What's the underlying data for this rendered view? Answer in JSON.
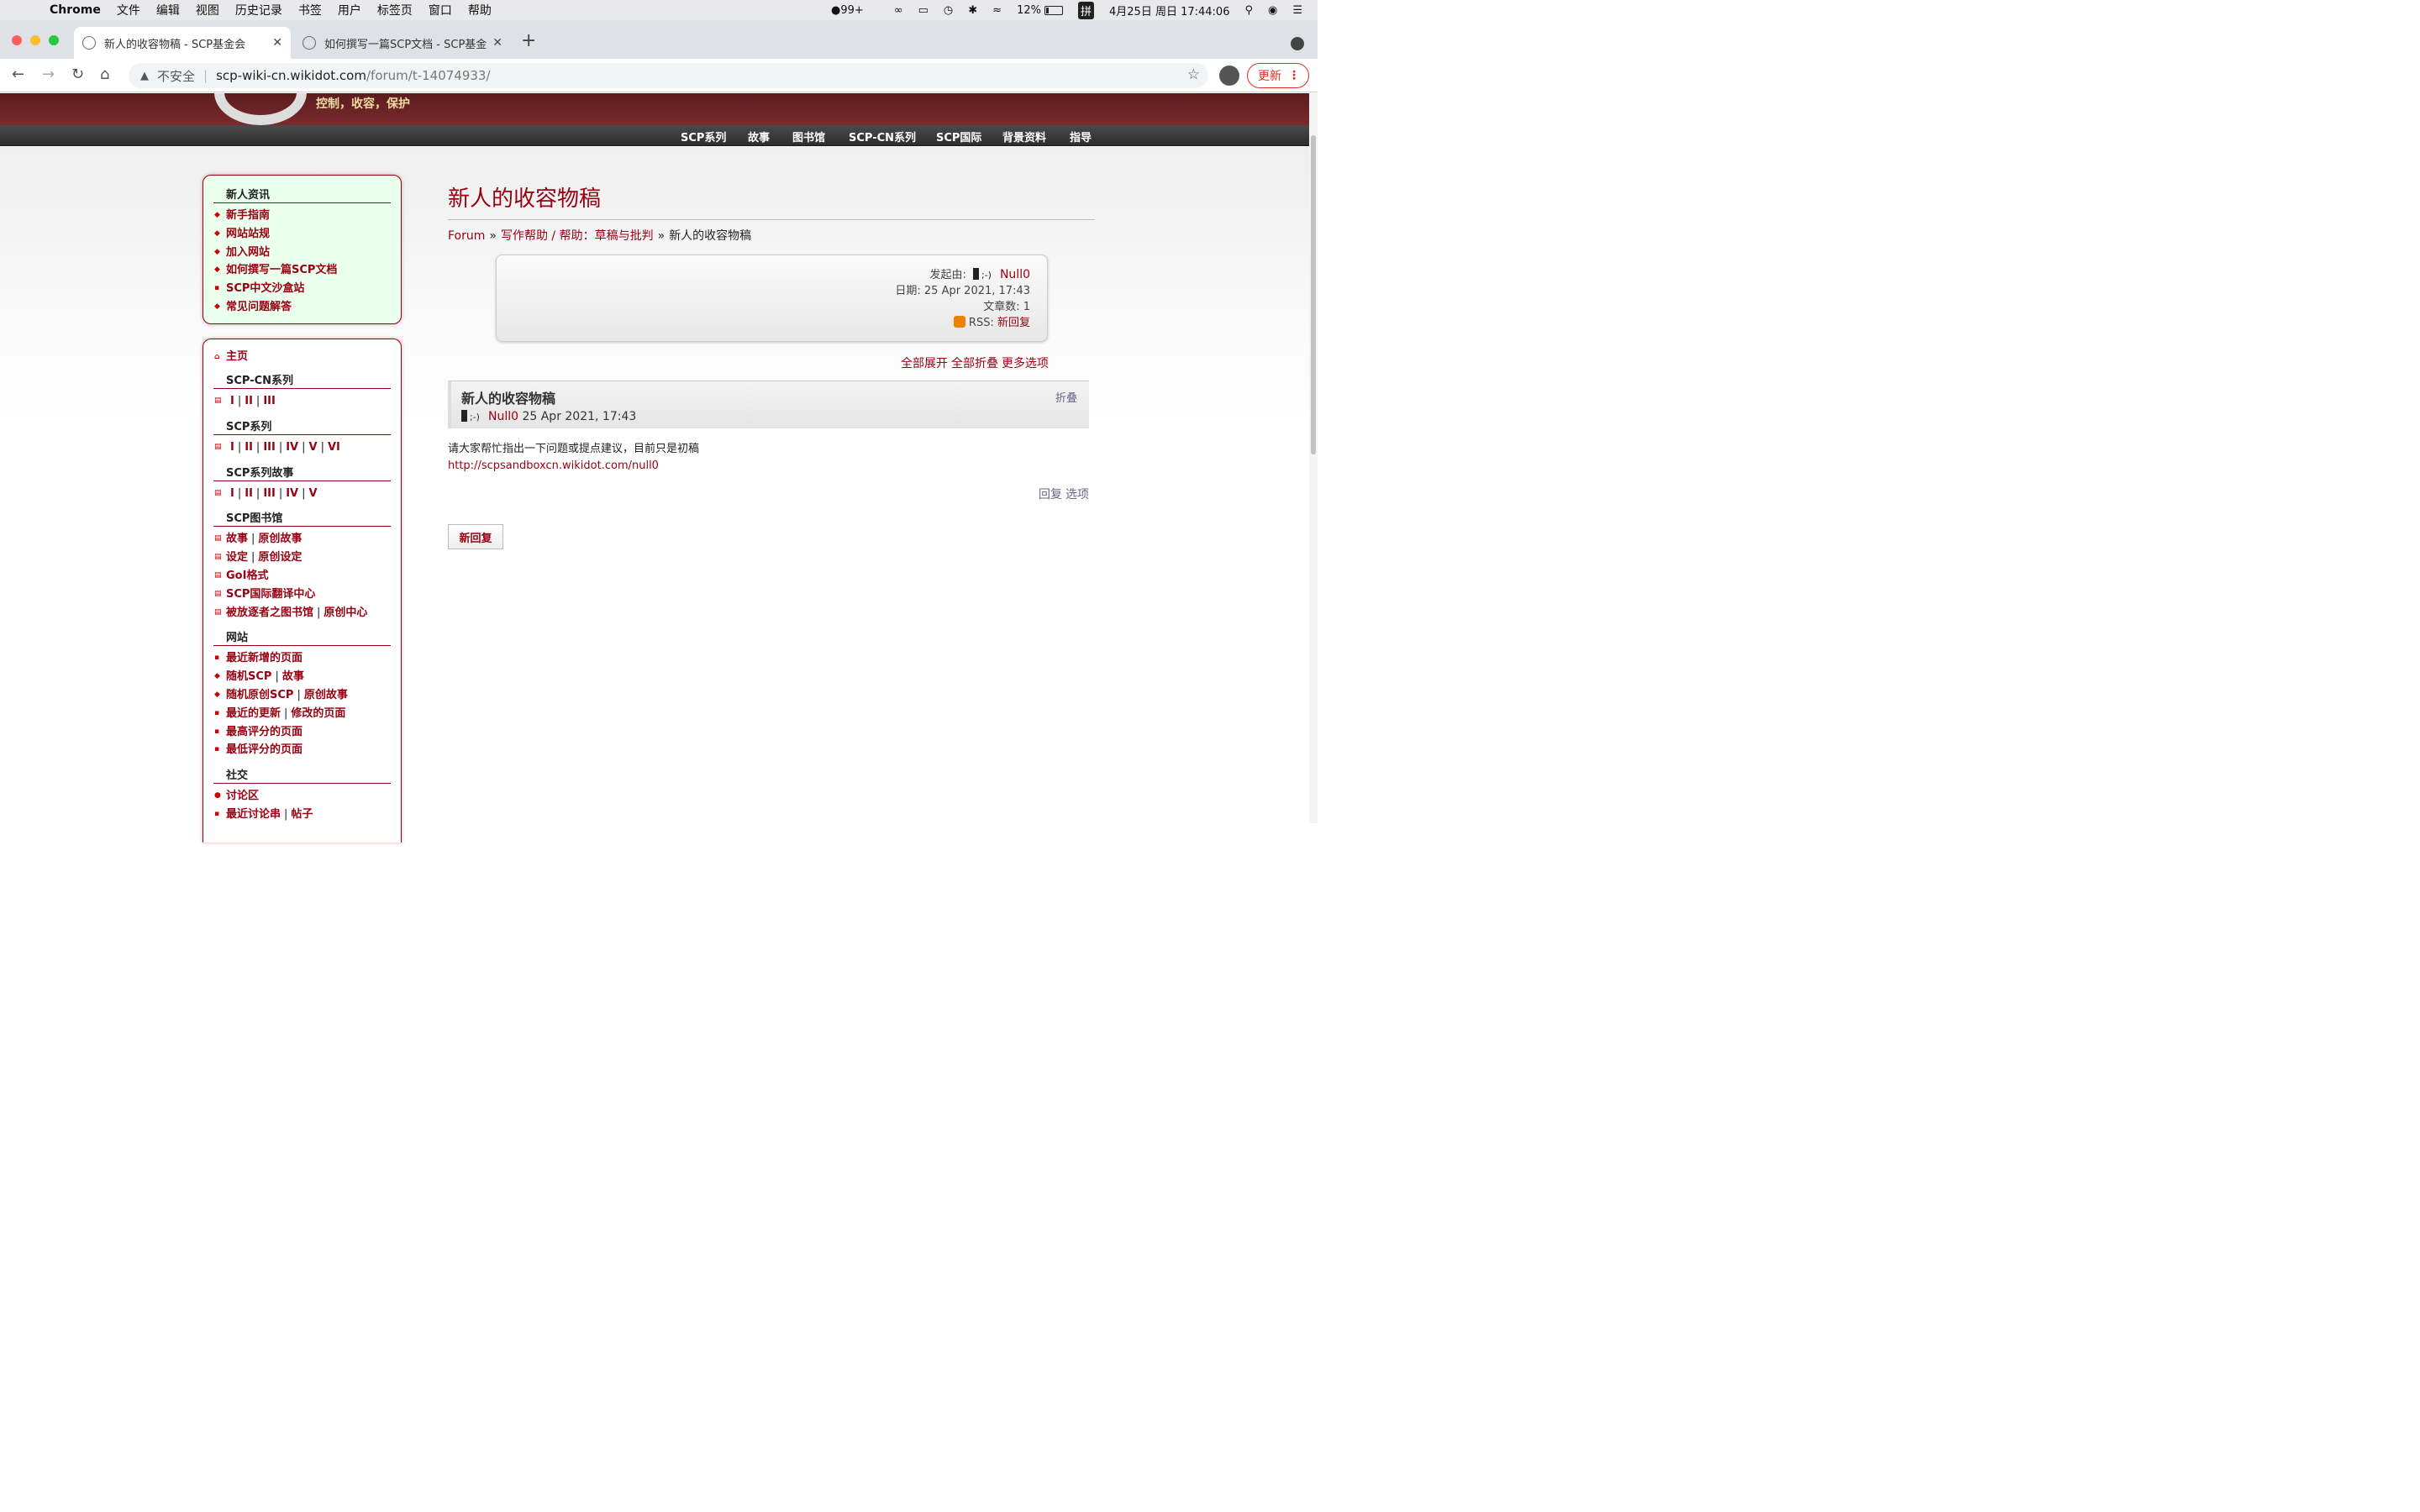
{
  "menubar": {
    "app": "Chrome",
    "items": [
      "文件",
      "编辑",
      "视图",
      "历史记录",
      "书签",
      "用户",
      "标签页",
      "窗口",
      "帮助"
    ],
    "qq_badge": "99+",
    "battery": "12%",
    "input_method": "拼",
    "datetime": "4月25日 周日 17:44:06"
  },
  "tabs": [
    {
      "title": "新人的收容物稿 - SCP基金会",
      "active": true
    },
    {
      "title": "如何撰写一篇SCP文档 - SCP基金",
      "active": false
    }
  ],
  "toolbar": {
    "insecure_label": "不安全",
    "url_host": "scp-wiki-cn.wikidot.com",
    "url_path": "/forum/t-14074933/",
    "update_label": "更新"
  },
  "site": {
    "slogan": "控制，收容，保护",
    "nav": [
      "SCP系列",
      "故事",
      "图书馆",
      "SCP-CN系列",
      "SCP国际",
      "背景资料",
      "指导"
    ]
  },
  "sidebar_news": {
    "heading": "新人资讯",
    "items": [
      "新手指南",
      "网站站规",
      "加入网站",
      "如何撰写一篇SCP文档",
      "SCP中文沙盒站",
      "常见问题解答"
    ]
  },
  "sidebar_main": {
    "home": "主页",
    "cn_series": {
      "heading": "SCP-CN系列",
      "links": [
        "I",
        "II",
        "III"
      ]
    },
    "series": {
      "heading": "SCP系列",
      "links": [
        "I",
        "II",
        "III",
        "IV",
        "V",
        "VI"
      ]
    },
    "series_tales": {
      "heading": "SCP系列故事",
      "links": [
        "I",
        "II",
        "III",
        "IV",
        "V"
      ]
    },
    "library": {
      "heading": "SCP图书馆",
      "row1": [
        "故事",
        "原创故事"
      ],
      "row2": [
        "设定",
        "原创设定"
      ],
      "row3": "GoI格式",
      "row4": "SCP国际翻译中心",
      "row5": [
        "被放逐者之图书馆",
        "原创中心"
      ]
    },
    "site_section": {
      "heading": "网站",
      "row1": "最近新增的页面",
      "row2": [
        "随机SCP",
        "故事"
      ],
      "row3": [
        "随机原创SCP",
        "原创故事"
      ],
      "row4": [
        "最近的更新",
        "修改的页面"
      ],
      "row5": "最高评分的页面",
      "row6": "最低评分的页面"
    },
    "social": {
      "heading": "社交",
      "row1": "讨论区",
      "row2": [
        "最近讨论串",
        "帖子"
      ]
    }
  },
  "page": {
    "title": "新人的收容物稿",
    "breadcrumbs": {
      "forum": "Forum",
      "category": "写作帮助 / 帮助：草稿与批判",
      "current": "新人的收容物稿"
    }
  },
  "thread_info": {
    "started_by_label": "发起由:",
    "face": ";-)",
    "author": "Null0",
    "date_label": "日期:",
    "date": "25 Apr 2021, 17:43",
    "posts_label": "文章数:",
    "posts": "1",
    "rss_label": "RSS:",
    "rss_link": "新回复"
  },
  "thread_options": {
    "expand": "全部展开",
    "fold": "全部折叠",
    "more": "更多选项"
  },
  "post": {
    "title": "新人的收容物稿",
    "face": ";-)",
    "author": "Null0",
    "date": "25 Apr 2021, 17:43",
    "fold": "折叠",
    "body": "请大家帮忙指出一下问题或提点建议，目前只是初稿",
    "link": "http://scpsandboxcn.wikidot.com/null0",
    "reply": "回复",
    "options": "选项"
  },
  "new_reply_label": "新回复"
}
